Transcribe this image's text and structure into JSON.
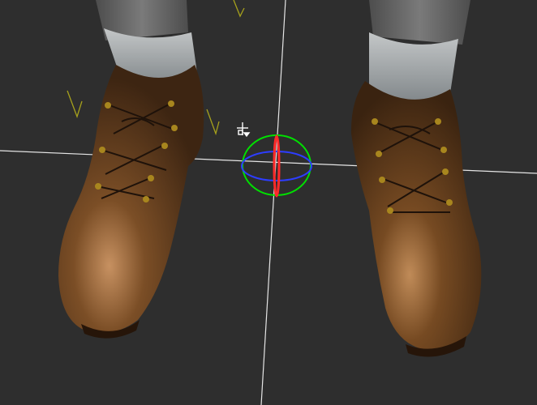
{
  "viewport": {
    "background": "#2e2e2e",
    "grid_color": "#e6e6e6"
  },
  "models": {
    "left_boot": {
      "upper_color": "#4b3420",
      "mid_color": "#6f4621",
      "highlight_color": "#b98656",
      "eyelet_color": "#a8861e"
    },
    "right_boot": {
      "upper_color": "#4b3420",
      "mid_color": "#6f4621",
      "highlight_color": "#b98656",
      "eyelet_color": "#a8861e"
    },
    "sock_color": "#9aa0a3",
    "leg_color": "#6a6a6a"
  },
  "gizmo": {
    "type": "rotate-gizmo",
    "axis_colors": {
      "x": "#ff2a2a",
      "y": "#00e000",
      "z": "#2d3dff"
    }
  },
  "icons": {
    "pivot": "pivot-cursor-icon",
    "light_markers": "light-marker-icon"
  }
}
